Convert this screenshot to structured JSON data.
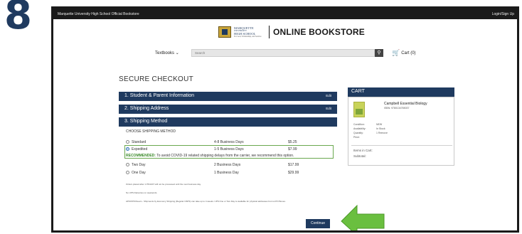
{
  "step_number": "8",
  "topbar": {
    "site_title": "Marquette University High School Official Bookstore",
    "login": "Login/Sign Up"
  },
  "header": {
    "school_name_line1": "MARQUETTE",
    "school_name_line2": "UNIVERSITY",
    "school_name_line3": "HIGH SCHOOL",
    "school_tagline": "For God, Scholarship, and Service",
    "store_title": "ONLINE BOOKSTORE"
  },
  "nav": {
    "textbooks": "Textbooks",
    "search_placeholder": "Search",
    "cart": "Cart (0)"
  },
  "checkout": {
    "title": "SECURE CHECKOUT",
    "sections": [
      {
        "label": "1. Student & Parent Information",
        "edit": "Edit"
      },
      {
        "label": "2. Shipping Address",
        "edit": "Edit"
      },
      {
        "label": "3. Shipping Method",
        "edit": ""
      }
    ],
    "choose_label": "CHOOSE SHIPPING METHOD",
    "options": [
      {
        "name": "Standard",
        "days": "4-8 Business Days",
        "price": "$5.25",
        "selected": false
      },
      {
        "name": "Expedited",
        "days": "1-5 Business Days",
        "price": "$7.99",
        "selected": true
      },
      {
        "name": "Two Day",
        "days": "2 Business Days",
        "price": "$17.99",
        "selected": false
      },
      {
        "name": "One Day",
        "days": "1 Business Day",
        "price": "$29.99",
        "selected": false
      }
    ],
    "recommended_label": "RECOMMENDED:",
    "recommended_text": "To avoid COVID-19 related shipping delays from the carrier, we recommend this option.",
    "fine_print": [
      "Orders placed after 1 PM EST will not be processed until the next business day.",
      "No UPS Deliveries on weekends.",
      "APO/FPO/Guam - Shipments by Economy Shipping (Regular USPS) can take up to 4 weeks. UPS One or Two Day is available for physical addresses but not PO Boxes."
    ],
    "continue": "Continue"
  },
  "cart": {
    "title": "CART",
    "book_title": "Campbell Essential Biology",
    "isbn": "ISBN: 9780134765037",
    "meta": [
      {
        "label": "Condition:",
        "value": "NEW"
      },
      {
        "label": "Availability:",
        "value": "In Stock"
      },
      {
        "label": "Quantity:",
        "value": "1 Remove"
      },
      {
        "label": "Price:",
        "value": ""
      }
    ],
    "items_in_cart": "Items in Cart:",
    "subtotal": "Subtotal:"
  },
  "colors": {
    "navy": "#1f3a5f",
    "accent_green": "#6abf3f",
    "recommend_green": "#3b8a2a"
  }
}
